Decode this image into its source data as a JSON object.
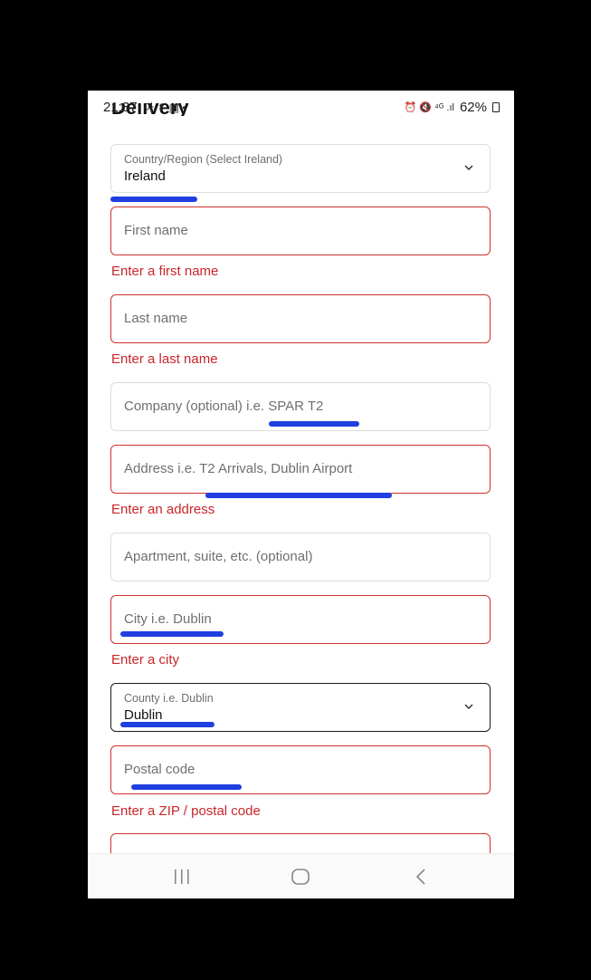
{
  "status": {
    "time": "21:37",
    "left_icons": "아 ⬆ ▣ •",
    "right_icons": "⏰ 🔇 ⁴ᴳ .ıl",
    "battery": "62%"
  },
  "page": {
    "heading": "Delivery"
  },
  "form": {
    "country": {
      "label": "Country/Region (Select Ireland)",
      "value": "Ireland"
    },
    "first_name": {
      "placeholder": "First name",
      "error": "Enter a first name"
    },
    "last_name": {
      "placeholder": "Last name",
      "error": "Enter a last name"
    },
    "company": {
      "placeholder": "Company (optional) i.e. SPAR T2"
    },
    "address": {
      "placeholder": "Address i.e. T2 Arrivals, Dublin Airport",
      "error": "Enter an address"
    },
    "apartment": {
      "placeholder": "Apartment, suite, etc. (optional)"
    },
    "city": {
      "placeholder": "City i.e. Dublin",
      "error": "Enter a city"
    },
    "county": {
      "label": "County i.e. Dublin",
      "value": "Dublin"
    },
    "postal": {
      "placeholder": "Postal code",
      "error": "Enter a ZIP / postal code"
    }
  },
  "colors": {
    "error": "#c9262a",
    "annotation": "#1f3fe0"
  },
  "nav": {
    "recents": "recents-icon",
    "home": "home-icon",
    "back": "back-icon"
  }
}
